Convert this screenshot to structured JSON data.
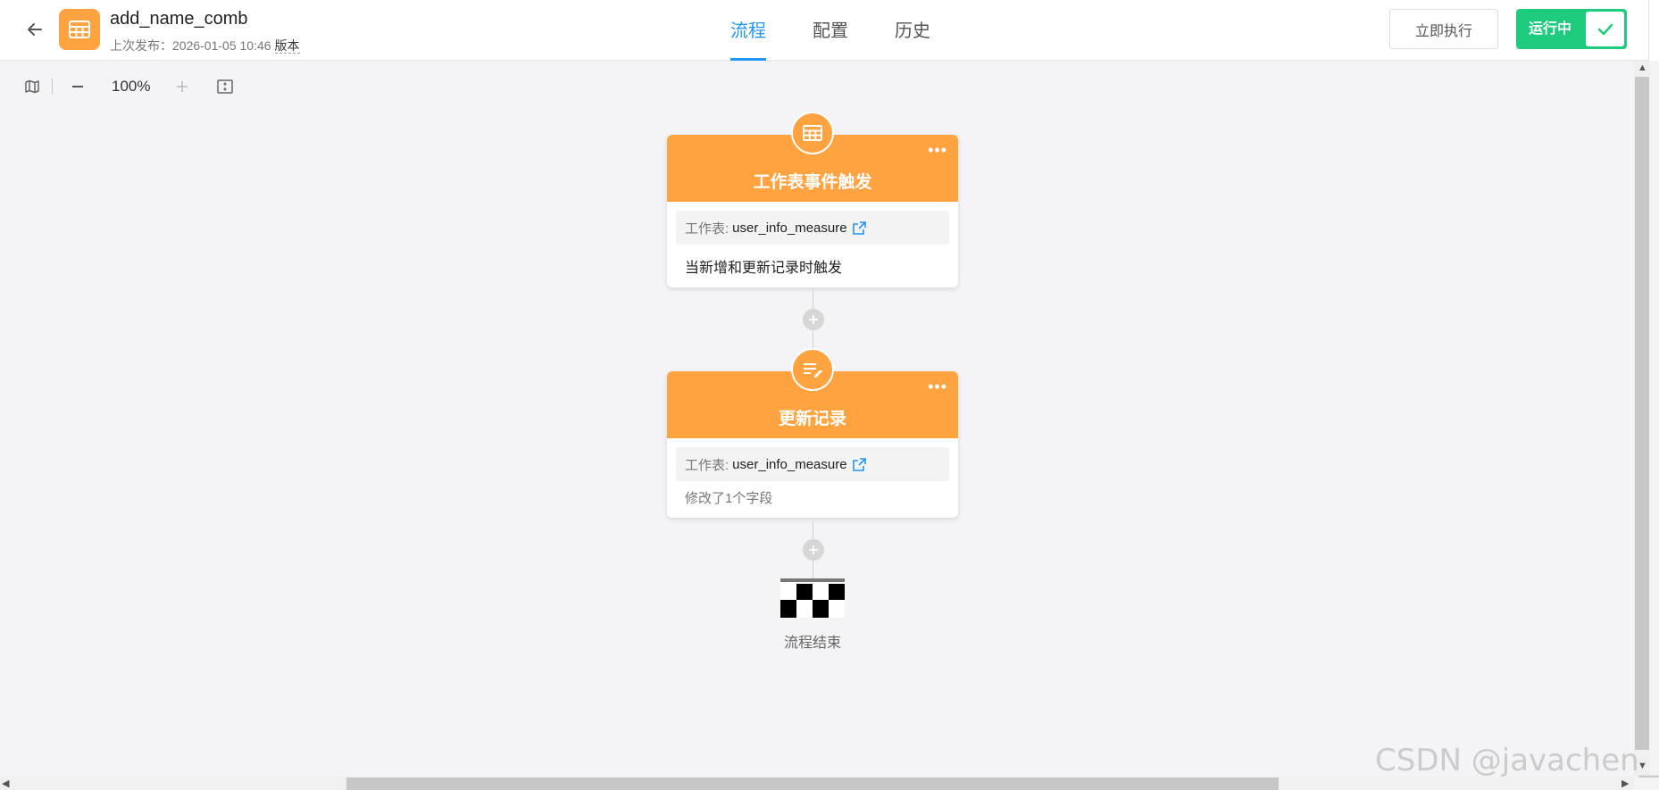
{
  "header": {
    "app_name": "add_name_comb",
    "publish_info": "上次发布：2026-01-05 10:46",
    "version_label": "版本",
    "tabs": [
      "流程",
      "配置",
      "历史"
    ],
    "active_tab": "流程",
    "execute_label": "立即执行",
    "status_label": "运行中",
    "accent_color": "#ffa340",
    "status_color": "#1fcb7c",
    "tab_active_color": "#2196f3"
  },
  "toolbar": {
    "zoom": "100%"
  },
  "nodes": [
    {
      "title": "工作表事件触发",
      "sheet_key": "工作表:",
      "sheet_value": "user_info_measure",
      "description": "当新增和更新记录时触发",
      "icon": "table-icon"
    },
    {
      "title": "更新记录",
      "sheet_key": "工作表:",
      "sheet_value": "user_info_measure",
      "description": "修改了1个字段",
      "icon": "edit-record-icon"
    }
  ],
  "end": {
    "label": "流程结束"
  },
  "watermark": "CSDN @javachen__"
}
